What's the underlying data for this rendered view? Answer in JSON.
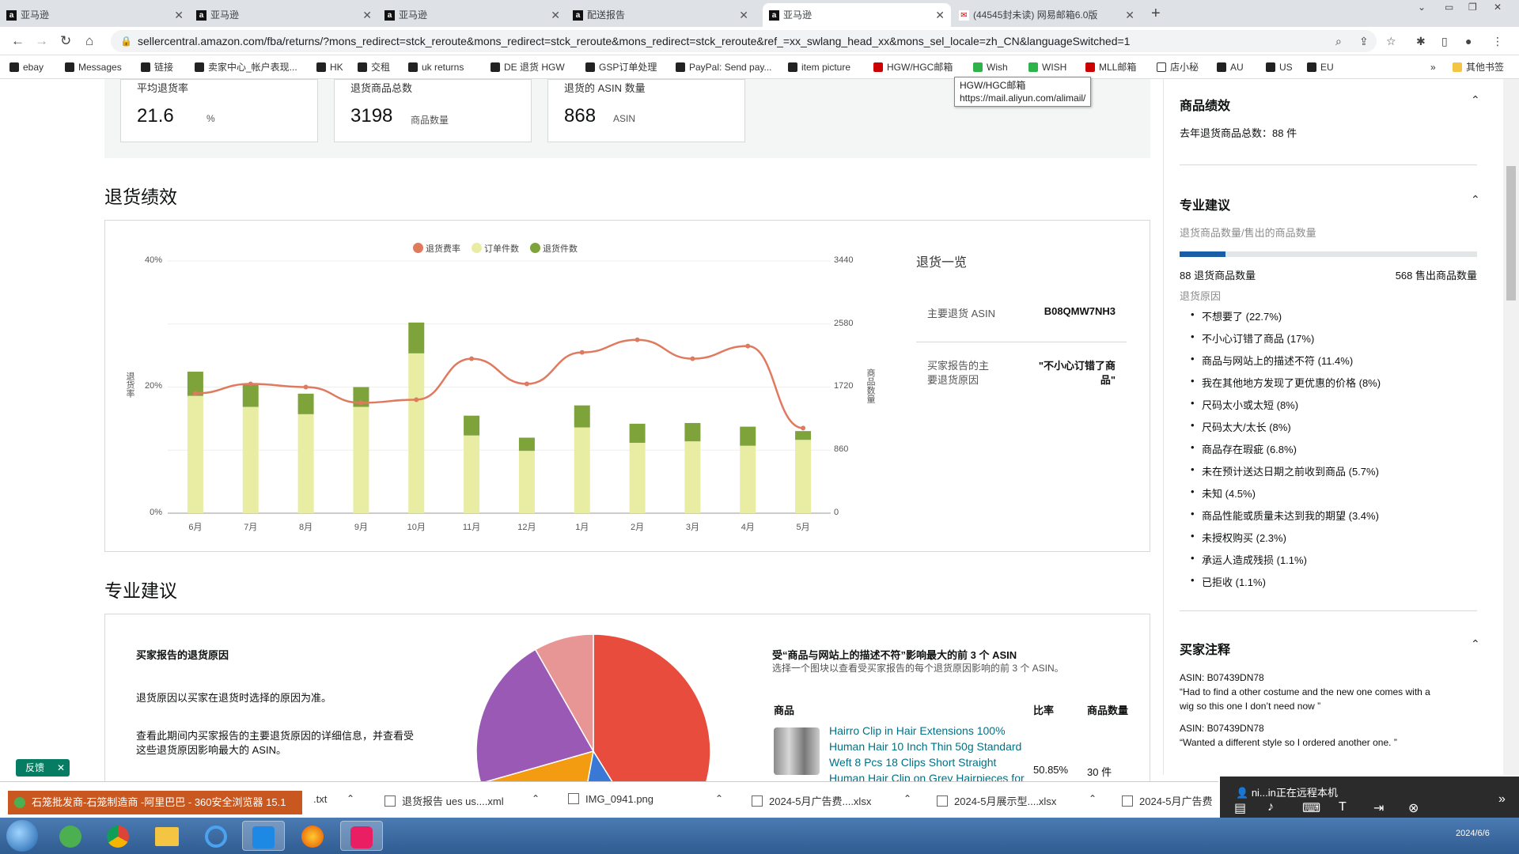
{
  "browser": {
    "tabs": [
      {
        "title": "亚马逊",
        "favicon": "a"
      },
      {
        "title": "亚马逊",
        "favicon": "a"
      },
      {
        "title": "亚马逊",
        "favicon": "a"
      },
      {
        "title": "配送报告",
        "favicon": "a"
      },
      {
        "title": "亚马逊",
        "favicon": "a"
      },
      {
        "title": "(44545封未读) 网易邮箱6.0版",
        "favicon": "netease"
      }
    ],
    "url": "sellercentral.amazon.com/fba/returns/?mons_redirect=stck_reroute&mons_redirect=stck_reroute&mons_redirect=stck_reroute&ref_=xx_swlang_head_xx&mons_sel_locale=zh_CN&languageSwitched=1",
    "bookmarks": [
      "ebay",
      "Messages",
      "链接",
      "卖家中心_帐户表现...",
      "HK",
      "交租",
      "uk returns",
      "DE 退货 HGW",
      "GSP订单处理",
      "PayPal: Send pay...",
      "item picture",
      "HGW/HGC邮箱",
      "Wish",
      "WISH",
      "MLL邮箱",
      "店小秘",
      "AU",
      "US",
      "EU"
    ],
    "bookmarks_more": "»",
    "other_bookmarks": "其他书签",
    "tooltip_line1": "HGW/HGC邮箱",
    "tooltip_line2": "https://mail.aliyun.com/alimail/"
  },
  "kpis": [
    {
      "label": "平均退货率",
      "value": "21.6",
      "unit": "%"
    },
    {
      "label": "退货商品总数",
      "value": "3198",
      "unit": "商品数量"
    },
    {
      "label": "退货的 ASIN 数量",
      "value": "868",
      "unit": "ASIN"
    }
  ],
  "return_perf_title": "退货绩效",
  "chart_data": {
    "type": "bar",
    "categories": [
      "6月",
      "7月",
      "8月",
      "9月",
      "10月",
      "11月",
      "12月",
      "1月",
      "2月",
      "3月",
      "4月",
      "5月"
    ],
    "series": [
      {
        "name": "订单件数",
        "type": "bar",
        "axis": "right",
        "values": [
          1600,
          1450,
          1350,
          1450,
          2180,
          1060,
          850,
          1170,
          960,
          980,
          920,
          1000
        ]
      },
      {
        "name": "退货件数",
        "type": "bar",
        "axis": "right",
        "values": [
          330,
          300,
          280,
          270,
          420,
          270,
          180,
          300,
          260,
          250,
          260,
          120
        ]
      },
      {
        "name": "退货费率",
        "type": "line",
        "axis": "left",
        "values": [
          19,
          20.5,
          20,
          17.5,
          18,
          24.5,
          20.5,
          25.5,
          27.5,
          24.5,
          26.5,
          13.5
        ]
      }
    ],
    "ylabel_left": "退货率",
    "ylabel_right": "商品数量",
    "left_ticks": [
      "40%",
      "20%",
      "0%"
    ],
    "right_ticks": [
      "3440",
      "2580",
      "1720",
      "860",
      "0"
    ],
    "ylim_left": [
      0,
      40
    ],
    "ylim_right": [
      0,
      3440
    ],
    "legend_position": "top",
    "colors": {
      "rate": "#e07a5f",
      "orders": "#e9eda4",
      "returns": "#7ea33b"
    }
  },
  "summary": {
    "title": "退货一览",
    "rows": [
      {
        "label": "主要退货 ASIN",
        "value": "B08QMW7NH3"
      },
      {
        "label_l1": "买家报告的主",
        "label_l2": "要退货原因",
        "value_l1": "\"不小心订错了商",
        "value_l2": "品\""
      }
    ]
  },
  "pro_title": "专业建议",
  "pie_card": {
    "heading": "买家报告的退货原因",
    "p1": "退货原因以买家在退货时选择的原因为准。",
    "p2_l1": "查看此期间内买家报告的主要退货原因的详细信息，并查看受",
    "p2_l2": "这些退货原因影响最大的 ASIN。",
    "pie_colors": [
      "#e74c3c",
      "#3a78d6",
      "#f39c12",
      "#9b59b6",
      "#e89595"
    ],
    "pie_values": [
      35,
      10,
      15,
      18,
      7
    ]
  },
  "asin_table": {
    "heading": "受“商品与网站上的描述不符”影响最大的前 3 个 ASIN",
    "sub": "选择一个图块以查看受买家报告的每个退货原因影响的前 3 个 ASIN。",
    "cols": [
      "商品",
      "比率",
      "商品数量"
    ],
    "row": {
      "name_l1": "Hairro Clip in Hair Extensions 100%",
      "name_l2": "Human Hair 10 Inch Thin 50g Standard",
      "name_l3": "Weft 8 Pcs 18 Clips Short Straight",
      "name_l4": "Human Hair Clip on Grey Hairpieces for",
      "rate": "50.85%",
      "count": "30 件"
    }
  },
  "right_panel": {
    "perf_title": "商品绩效",
    "perf_text": "去年退货商品总数：88 件",
    "advice_title": "专业建议",
    "advice_sub": "退货商品数量/售出的商品数量",
    "progress": 0.155,
    "returned_label": "88 退货商品数量",
    "sold_label": "568 售出商品数量",
    "reasons_title": "退货原因",
    "reasons": [
      "不想要了 (22.7%)",
      "不小心订错了商品 (17%)",
      "商品与网站上的描述不符 (11.4%)",
      "我在其他地方发现了更优惠的价格 (8%)",
      "尺码太小或太短 (8%)",
      "尺码太大/太长 (8%)",
      "商品存在瑕疵 (6.8%)",
      "未在预计送达日期之前收到商品 (5.7%)",
      "未知 (4.5%)",
      "商品性能或质量未达到我的期望 (3.4%)",
      "未授权购买 (2.3%)",
      "承运人造成残损 (1.1%)",
      "已拒收 (1.1%)"
    ],
    "comments_title": "买家注释",
    "comments": [
      {
        "asin": "ASIN: B07439DN78",
        "text_l1": "“Had to find a other costume and the new one comes with a",
        "text_l2": "wig so this one I don’t need now ”"
      },
      {
        "asin": "ASIN: B07439DN78",
        "text_l1": "“Wanted a different style so I ordered another one. ”",
        "text_l2": ""
      }
    ]
  },
  "feedback": "反馈",
  "notification": "石笼批发商-石笼制造商 -阿里巴巴 - 360安全浏览器 15.1",
  "downloads": [
    ".txt",
    "退货报告 ues us....xml",
    "IMG_0941.png",
    "2024-5月广告费....xlsx",
    "2024-5月展示型....xlsx",
    "2024-5月广告费"
  ],
  "remote": {
    "text": "ni...in正在远程本机"
  },
  "clock": "2024/6/6"
}
